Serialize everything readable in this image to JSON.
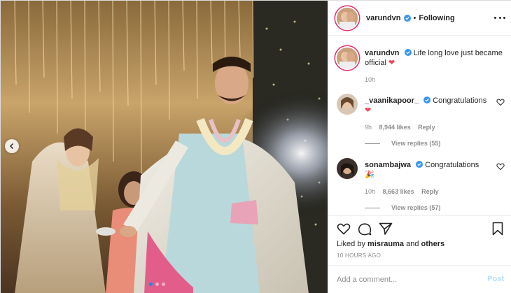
{
  "post": {
    "author": "varundvn",
    "follow_status": "Following",
    "dot": "•"
  },
  "caption": {
    "username": "varundvn",
    "text": "Life long love just became official",
    "heart": "❤",
    "time": "10h"
  },
  "comments": [
    {
      "username": "_vaanikapoor_",
      "text": "Congratulations",
      "emoji": "❤",
      "time": "9h",
      "likes": "8,944 likes",
      "reply": "Reply",
      "view_replies": "View replies (55)"
    },
    {
      "username": "sonambajwa",
      "text": "Congratulations",
      "emoji": "🎉",
      "time": "10h",
      "likes": "8,663 likes",
      "reply": "Reply",
      "view_replies": "View replies (57)"
    }
  ],
  "actions": {
    "liked_by_prefix": "Liked by",
    "liked_by_user": "misrauma",
    "liked_by_and": "and",
    "liked_by_others": "others",
    "time_ago": "10 HOURS AGO"
  },
  "composer": {
    "placeholder": "Add a comment...",
    "post_label": "Post"
  },
  "carousel": {
    "index": 1,
    "count": 3
  },
  "icons": {
    "verified": "verified-badge-icon",
    "like": "heart-icon",
    "comment": "comment-bubble-icon",
    "share": "paper-plane-icon",
    "save": "bookmark-icon",
    "more": "more-options-icon",
    "prev": "chevron-left-icon"
  },
  "colors": {
    "verified_blue": "#3897f0",
    "heart_red": "#ed4956",
    "link_blue": "#0095f6",
    "post_disabled": "#b2dffc",
    "muted": "#8e8e8e"
  }
}
